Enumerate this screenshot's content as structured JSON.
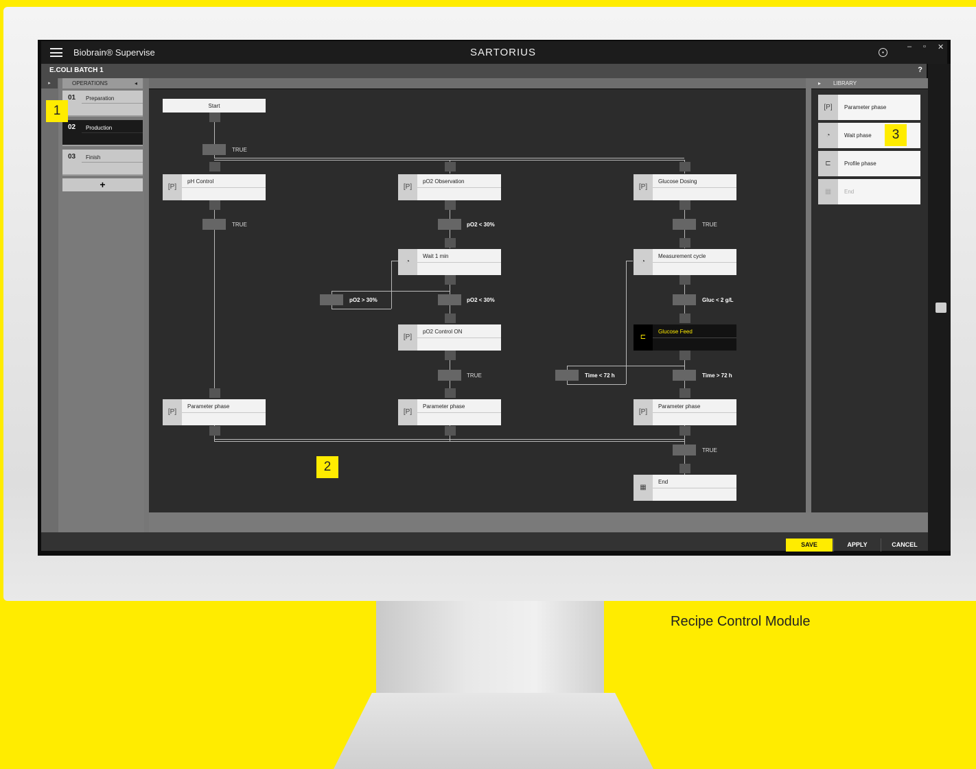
{
  "app": {
    "title": "Biobrain® Supervise",
    "brand": "SARTORIUS",
    "batch": "E.COLI BATCH 1",
    "help": "?",
    "win_minimize": "–",
    "win_restore": "▫",
    "win_close": "✕"
  },
  "operations": {
    "header": "OPERATIONS",
    "collapse": "◂",
    "expand": "▸",
    "items": [
      {
        "num": "01",
        "label": "Preparation"
      },
      {
        "num": "02",
        "label": "Production"
      },
      {
        "num": "03",
        "label": "Finish"
      }
    ],
    "add": "+"
  },
  "library": {
    "header": "LIBRARY",
    "expand": "▸",
    "items": [
      {
        "label": "Parameter phase",
        "icon": "[P]"
      },
      {
        "label": "Wait phase",
        "icon": "◔"
      },
      {
        "label": "Profile phase",
        "icon": "⊏"
      },
      {
        "label": "End",
        "icon": "▦"
      }
    ]
  },
  "flow": {
    "start": "Start",
    "nodes": {
      "ph_control": "pH Control",
      "po2_observation": "pO2 Observation",
      "glucose_dosing": "Glucose Dosing",
      "wait_1min": "Wait 1 min",
      "measurement_cycle": "Measurement cycle",
      "po2_control_on": "pO2 Control ON",
      "glucose_feed": "Glucose Feed",
      "param_phase_1": "Parameter phase",
      "param_phase_2": "Parameter phase",
      "param_phase_3": "Parameter phase",
      "end": "End"
    },
    "transitions": {
      "t_start": "TRUE",
      "t_ph": "TRUE",
      "t_po2_lt_1": "pO2 < 30%",
      "t_gd": "TRUE",
      "t_po2_gt": "pO2 > 30%",
      "t_po2_lt_2": "pO2 < 30%",
      "t_gluc": "Gluc < 2 g/L",
      "t_po2on": "TRUE",
      "t_time_lt": "Time < 72 h",
      "t_time_gt": "Time > 72 h",
      "t_end": "TRUE"
    },
    "icons": {
      "param": "[P]",
      "wait": "◔",
      "profile": "⊏",
      "end": "▦"
    }
  },
  "footer": {
    "save": "SAVE",
    "apply": "APPLY",
    "cancel": "CANCEL"
  },
  "markers": [
    "1",
    "2",
    "3"
  ],
  "caption": "Recipe Control Module",
  "colors": {
    "accent": "#ffec00",
    "canvas": "#2c2c2c",
    "titlebar": "#1c1c1c"
  }
}
